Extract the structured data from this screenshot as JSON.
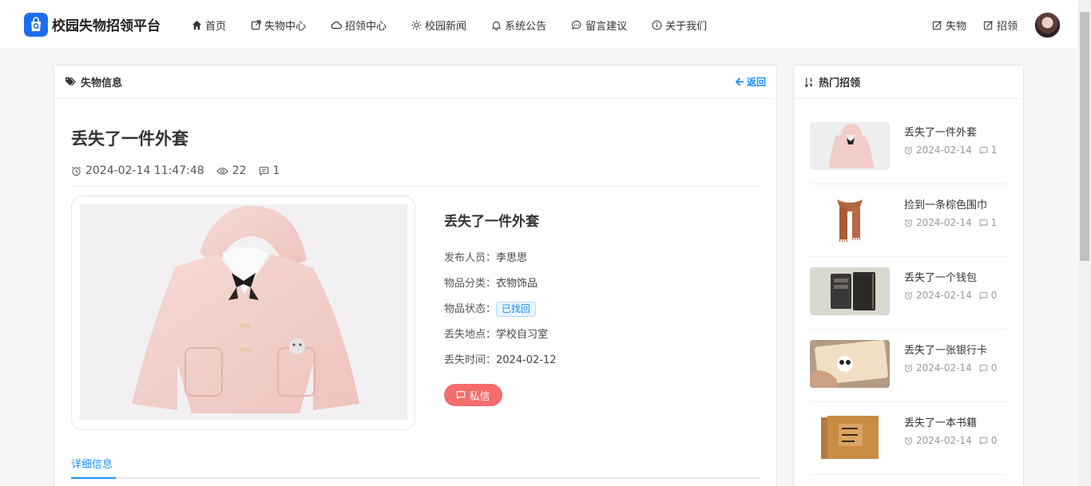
{
  "brand": {
    "title": "校园失物招领平台"
  },
  "nav": [
    {
      "label": "首页"
    },
    {
      "label": "失物中心"
    },
    {
      "label": "招领中心"
    },
    {
      "label": "校园新闻"
    },
    {
      "label": "系统公告"
    },
    {
      "label": "留言建议"
    },
    {
      "label": "关于我们"
    }
  ],
  "header_right": {
    "lost_label": "失物",
    "found_label": "招领"
  },
  "main": {
    "section_title": "失物信息",
    "back_label": "返回",
    "post": {
      "title": "丢失了一件外套",
      "datetime": "2024-02-14 11:47:48",
      "views": "22",
      "comments": "1"
    },
    "info": {
      "title": "丢失了一件外套",
      "publisher_label": "发布人员：",
      "publisher": "李思思",
      "category_label": "物品分类：",
      "category": "衣物饰品",
      "status_label": "物品状态：",
      "status": "已找回",
      "place_label": "丢失地点：",
      "place": "学校自习室",
      "time_label": "丢失时间：",
      "time": "2024-02-12"
    },
    "pm_label": "私信",
    "tab_label": "详细信息"
  },
  "side": {
    "title": "热门招领",
    "items": [
      {
        "title": "丢失了一件外套",
        "date": "2024-02-14",
        "comments": "1",
        "thumb": "coat"
      },
      {
        "title": "捡到一条棕色围巾",
        "date": "2024-02-14",
        "comments": "1",
        "thumb": "scarf"
      },
      {
        "title": "丢失了一个钱包",
        "date": "2024-02-14",
        "comments": "0",
        "thumb": "wallet"
      },
      {
        "title": "丢失了一张银行卡",
        "date": "2024-02-14",
        "comments": "0",
        "thumb": "bank-card"
      },
      {
        "title": "丢失了一本书籍",
        "date": "2024-02-14",
        "comments": "0",
        "thumb": "book"
      }
    ]
  },
  "colors": {
    "brand": "#1e6cf0",
    "accent": "#1890ff",
    "pm_button": "#f56c6c"
  }
}
